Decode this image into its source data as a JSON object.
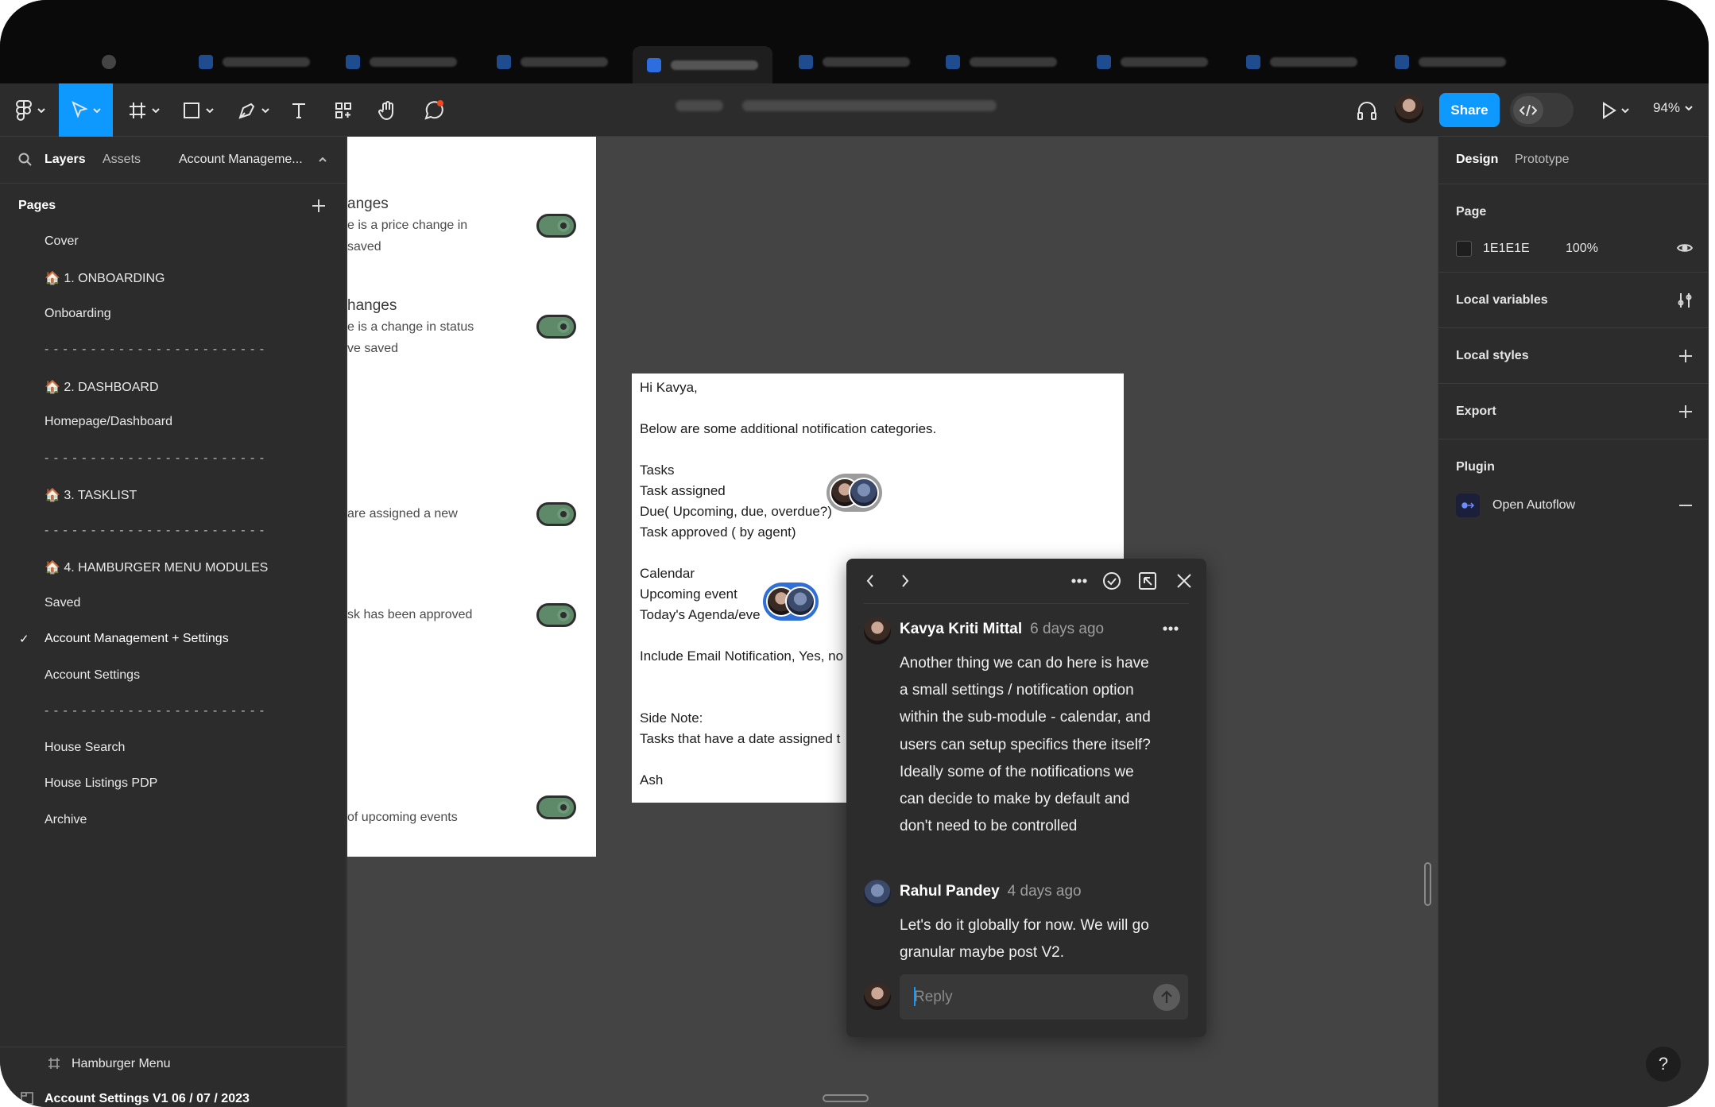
{
  "toolbar": {
    "share_label": "Share",
    "zoom": "94%"
  },
  "left_panel": {
    "tabs": [
      "Layers",
      "Assets"
    ],
    "current_page_dropdown": "Account Manageme...",
    "pages_title": "Pages",
    "pages": [
      {
        "label": "Cover"
      },
      {
        "label": "🏠 1. ONBOARDING"
      },
      {
        "label": "Onboarding"
      },
      {
        "label": "- - - - - - - - - - - - - - - - - - - - - - - -",
        "separator": true
      },
      {
        "label": "🏠 2. DASHBOARD"
      },
      {
        "label": "Homepage/Dashboard"
      },
      {
        "label": "- - - - - - - - - - - - - - - - - - - - - - - -",
        "separator": true
      },
      {
        "label": "🏠 3. TASKLIST"
      },
      {
        "label": "- - - - - - - - - - - - - - - - - - - - - - - -",
        "separator": true
      },
      {
        "label": "🏠 4. HAMBURGER MENU MODULES"
      },
      {
        "label": "Saved"
      },
      {
        "label": "Account Management + Settings",
        "selected": true
      },
      {
        "label": "Account Settings"
      },
      {
        "label": "- - - - - - - - - - - - - - - - - - - - - - - -",
        "separator": true
      },
      {
        "label": "House Search"
      },
      {
        "label": "House Listings PDP"
      },
      {
        "label": "Archive"
      }
    ],
    "layers": [
      "Hamburger Menu",
      "Account Settings V1 06 / 07 / 2023"
    ]
  },
  "canvas": {
    "artboard_texts": [
      {
        "text": "anges",
        "big": true
      },
      {
        "text": "e is a price change in"
      },
      {
        "text": "saved"
      },
      {
        "text": "hanges",
        "big": true
      },
      {
        "text": "e is a change in status"
      },
      {
        "text": "ve saved"
      },
      {
        "text": "are assigned a new"
      },
      {
        "text": "sk has been approved"
      },
      {
        "text": "of upcoming events"
      }
    ],
    "email_lines": [
      "Hi Kavya,",
      "Below are some additional notification categories.",
      "Tasks",
      "Task assigned",
      "Due( Upcoming, due, overdue?)",
      "Task approved ( by agent)",
      "Calendar",
      "Upcoming event",
      "Today's Agenda/eve",
      "Include Email Notification, Yes, no",
      "Side Note:",
      "Tasks that have a date assigned t",
      "Ash"
    ]
  },
  "comment_thread": {
    "comments": [
      {
        "author": "Kavya Kriti Mittal",
        "time": "6 days ago",
        "body": "Another thing we can do here is have a small settings / notification option within the sub-module - calendar, and users can setup specifics there itself? Ideally some of the notifications we can decide to make by default and don't need to be controlled"
      },
      {
        "author": "Rahul Pandey",
        "time": "4 days ago",
        "body": "Let's do it globally for now. We will go granular maybe post V2."
      }
    ],
    "reply_placeholder": "Reply"
  },
  "right_panel": {
    "tabs": [
      "Design",
      "Prototype"
    ],
    "page_label": "Page",
    "page_color": "1E1E1E",
    "page_opacity": "100%",
    "local_variables": "Local variables",
    "local_styles": "Local styles",
    "export": "Export",
    "plugin_label": "Plugin",
    "plugin_item": "Open Autoflow"
  },
  "help_label": "?"
}
